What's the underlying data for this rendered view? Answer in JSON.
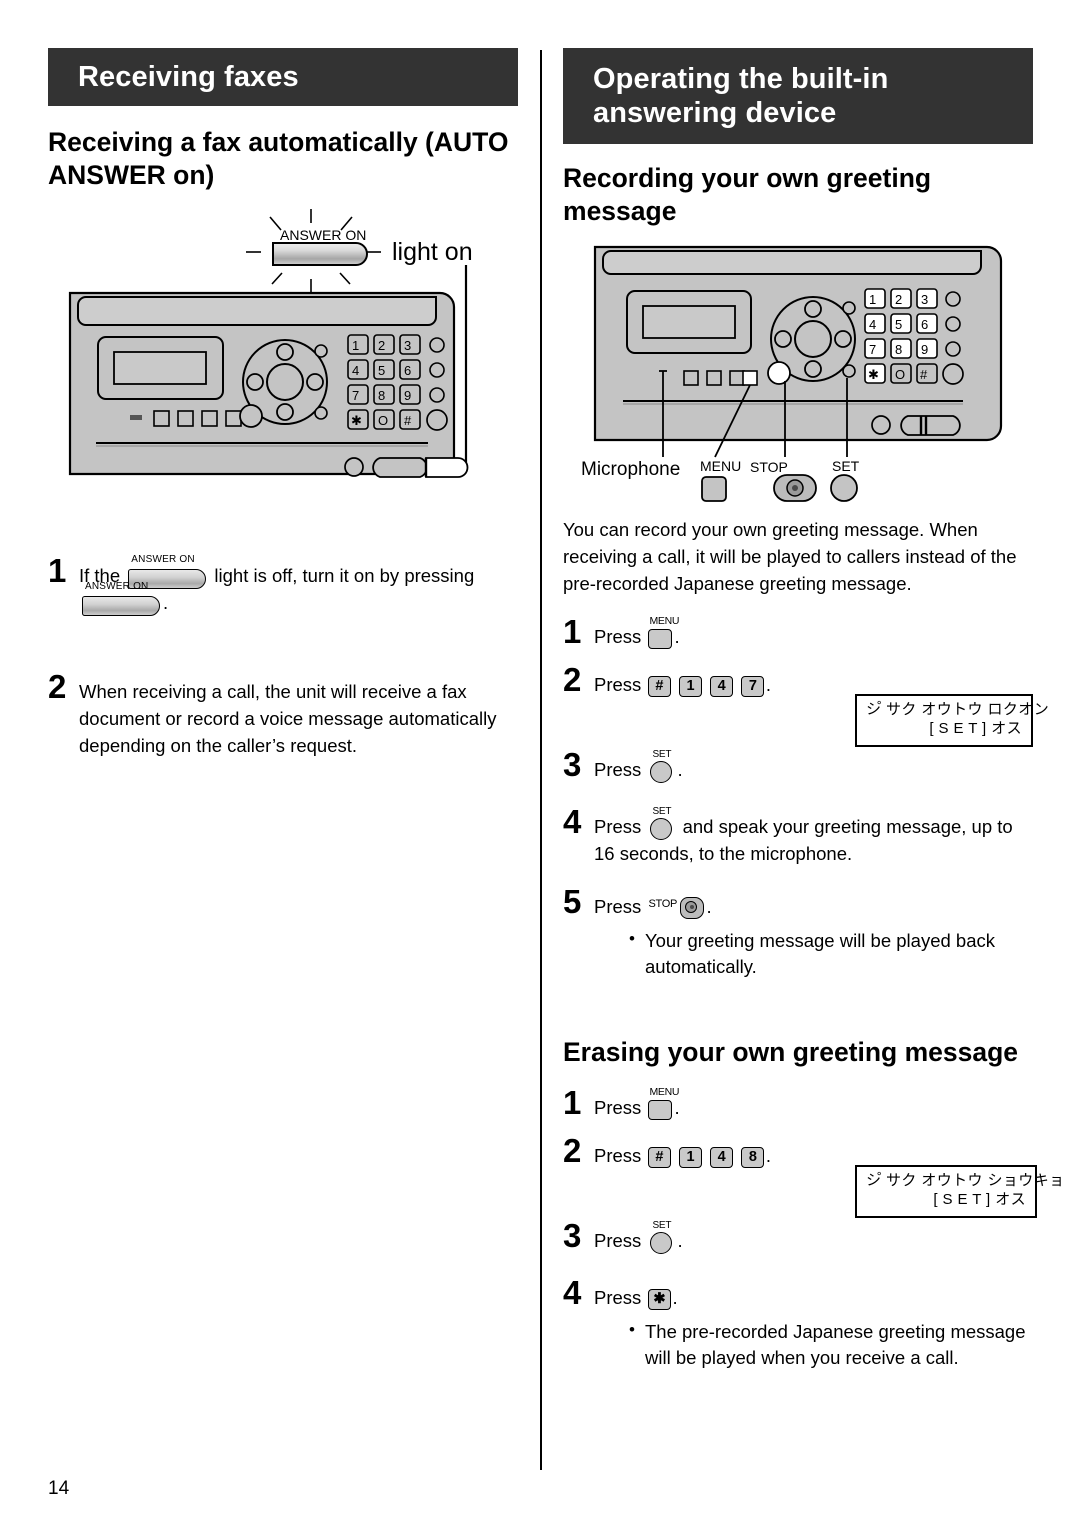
{
  "page": {
    "number": "14"
  },
  "left_column": {
    "section_bar": "Receiving faxes",
    "heading": "Receiving a fax automatically (AUTO ANSWER on)",
    "figure": {
      "callout_label": "light on",
      "answer_on_label": "ANSWER ON",
      "keypad": [
        "1",
        "2",
        "3",
        "4",
        "5",
        "6",
        "7",
        "8",
        "9",
        "✱",
        "O",
        "#"
      ]
    },
    "steps": [
      {
        "number": "1",
        "text_before": "If the",
        "key_1_label": "ANSWER ON",
        "text_middle": "light is off, turn it on by pressing",
        "key_2_label": "ANSWER ON",
        "text_after": "."
      },
      {
        "number": "2",
        "text": "When receiving a call, the unit will receive a fax document or record a voice message automatically depending on the caller’s request."
      }
    ]
  },
  "right_column": {
    "section_bar": "Operating the built-in answering device",
    "heading_record": "Recording your own greeting message",
    "figure": {
      "label_microphone": "Microphone",
      "label_menu": "MENU",
      "label_stop": "STOP",
      "label_set": "SET",
      "keypad": [
        "1",
        "2",
        "3",
        "4",
        "5",
        "6",
        "7",
        "8",
        "9",
        "✱",
        "O",
        "#"
      ]
    },
    "intro": "You can record your own greeting message. When receiving a call, it will be played to callers instead of the pre-recorded Japanese greeting message.",
    "record_steps": [
      {
        "number": "1",
        "text_before": "Press",
        "key": "MENU",
        "text_after": "."
      },
      {
        "number": "2",
        "text_before": "Press",
        "keys": [
          "#",
          "1",
          "4",
          "7"
        ],
        "text_after": "."
      },
      {
        "number": "3",
        "text_before": "Press",
        "key": "SET",
        "text_after": "."
      },
      {
        "number": "4",
        "text_before": "Press",
        "key": "SET",
        "text_after": "and speak your greeting message, up to 16 seconds, to the microphone."
      },
      {
        "number": "5",
        "text_before": "Press",
        "key": "STOP",
        "text_after": "."
      }
    ],
    "record_note": "Your greeting message will be played back automatically.",
    "record_lcd": {
      "line1": "シ゚ サク  オウトウ  ロクオン",
      "line2": "[ S E T ] オス"
    },
    "heading_erase": "Erasing your own greeting message",
    "erase_steps": [
      {
        "number": "1",
        "text_before": "Press",
        "key": "MENU",
        "text_after": "."
      },
      {
        "number": "2",
        "text_before": "Press",
        "keys": [
          "#",
          "1",
          "4",
          "8"
        ],
        "text_after": "."
      },
      {
        "number": "3",
        "text_before": "Press",
        "key": "SET",
        "text_after": "."
      },
      {
        "number": "4",
        "text_before": "Press",
        "key": "✱",
        "text_after": "."
      }
    ],
    "erase_note": "The pre-recorded Japanese greeting message will be played when you receive a call.",
    "erase_lcd": {
      "line1": "シ゚ サク  オウトウ  ショウキョ",
      "line2": "[ S E T ] オス"
    }
  },
  "colors": {
    "header_bar": "#333333",
    "panel_body": "#c4c4c4",
    "key_face": "#c9c9c9"
  }
}
